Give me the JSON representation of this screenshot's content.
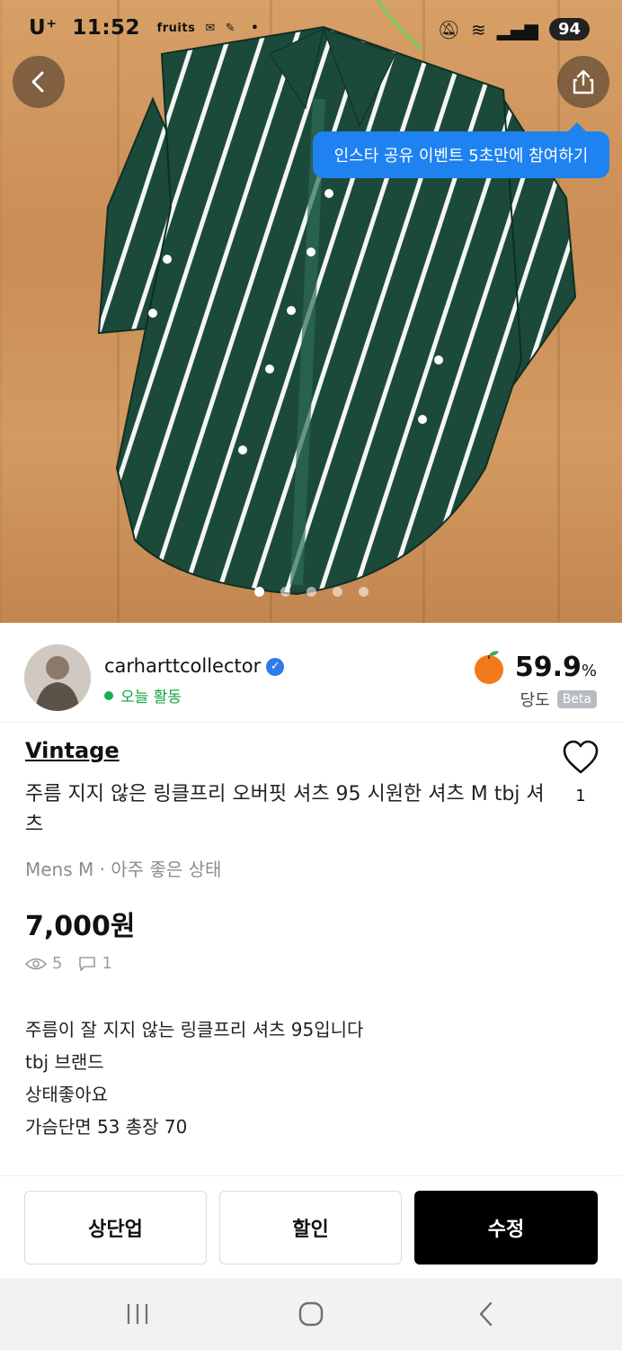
{
  "status_bar": {
    "time": "11:52",
    "carrier": "U⁺",
    "mini_icons": "fruits",
    "battery": "94"
  },
  "tooltip": "인스타 공유 이벤트 5초만에 참여하기",
  "seller": {
    "name": "carharttcollector",
    "activity": "오늘 활동",
    "temperature": "59.9",
    "temperature_unit": "%",
    "temperature_label": "당도",
    "beta": "Beta"
  },
  "product": {
    "category": "Vintage",
    "title": "주름 지지 않은 링클프리 오버핏 셔츠 95 시원한 셔츠 M tbj 셔츠",
    "meta": "Mens M · 아주 좋은 상태",
    "price": "7,000원",
    "views": "5",
    "chats": "1",
    "likes": "1",
    "description": [
      "주름이 잘 지지 않는 링클프리 셔츠 95입니다",
      "tbj 브랜드",
      "상태좋아요",
      "가슴단면 53 총장 70"
    ]
  },
  "image_pager": {
    "count": 5,
    "active_index": 0
  },
  "actions": {
    "bump": "상단업",
    "discount": "할인",
    "edit": "수정"
  },
  "colors": {
    "accent_blue": "#1e82f0",
    "active_green": "#18b04a",
    "shirt_green": "#1c4a3a"
  }
}
